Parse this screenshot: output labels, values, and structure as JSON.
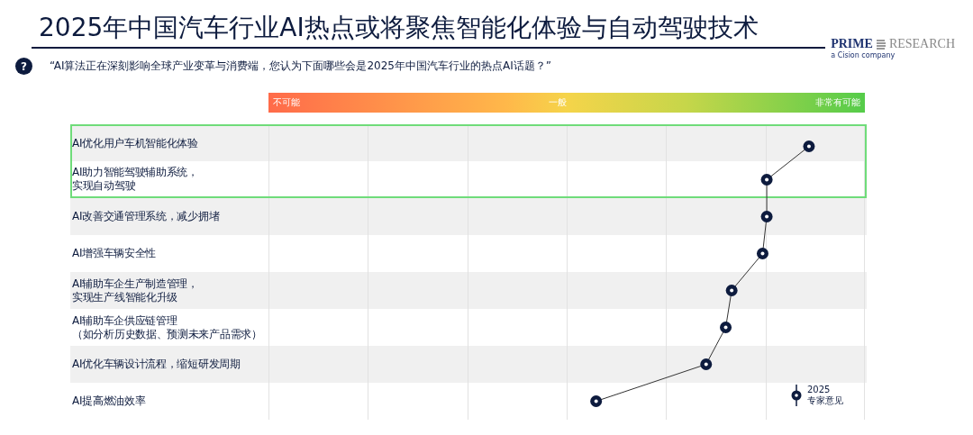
{
  "title": "2025年中国汽车行业AI热点或将聚焦智能化体验与自动驾驶技术",
  "logo": {
    "brand": "PRIME",
    "research": "RESEARCH",
    "tagline": "a Cision company"
  },
  "question": {
    "icon": "?",
    "text": "“AI算法正在深刻影响全球产业变革与消费端，您认为下面哪些会是2025年中国汽车行业的热点AI话题？”"
  },
  "scale": {
    "low": "不可能",
    "mid": "一般",
    "high": "非常有可能"
  },
  "rows": [
    {
      "label": [
        "AI优化用户车机智能化体验"
      ],
      "level": 0.909,
      "highlighted": true
    },
    {
      "label": [
        "AI助力智能驾驶辅助系统，",
        "实现自动驾驶"
      ],
      "level": 0.838,
      "highlighted": true
    },
    {
      "label": [
        "AI改善交通管理系统，减少拥堵"
      ],
      "level": 0.838,
      "highlighted": false
    },
    {
      "label": [
        "AI增强车辆安全性"
      ],
      "level": 0.831,
      "highlighted": false
    },
    {
      "label": [
        "AI辅助车企生产制造管理，",
        "实现生产线智能化升级"
      ],
      "level": 0.779,
      "highlighted": false
    },
    {
      "label": [
        "AI辅助车企供应链管理",
        "（如分析历史数据、预测未来产品需求）"
      ],
      "level": 0.769,
      "highlighted": false
    },
    {
      "label": [
        "AI优化车辆设计流程，缩短研发周期"
      ],
      "level": 0.736,
      "highlighted": false
    },
    {
      "label": [
        "AI提高燃油效率"
      ],
      "level": 0.551,
      "highlighted": false
    }
  ],
  "legend": {
    "year": "2025",
    "label": "专家意见"
  }
}
